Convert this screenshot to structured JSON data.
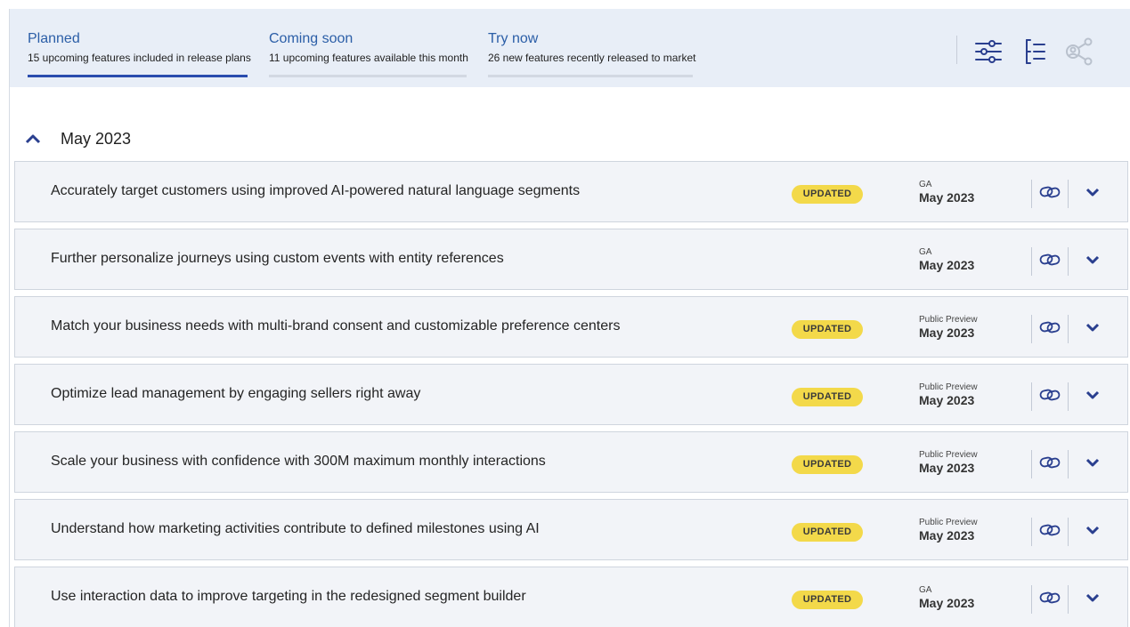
{
  "tabs": [
    {
      "title": "Planned",
      "subtitle": "15 upcoming features included in release plans",
      "active": true
    },
    {
      "title": "Coming soon",
      "subtitle": "11 upcoming features available this month",
      "active": false
    },
    {
      "title": "Try now",
      "subtitle": "26 new features recently released to market",
      "active": false
    }
  ],
  "toolbar": {
    "filter_icon": "filter-sliders-icon",
    "list_icon": "list-view-icon",
    "share_icon": "share-icon"
  },
  "month_group": {
    "label": "May 2023",
    "expanded": true
  },
  "features": [
    {
      "title": "Accurately target customers using improved AI-powered natural language segments",
      "badge": "UPDATED",
      "stage": "GA",
      "date": "May 2023"
    },
    {
      "title": "Further personalize journeys using custom events with entity references",
      "badge": "",
      "stage": "GA",
      "date": "May 2023"
    },
    {
      "title": "Match your business needs with multi-brand consent and customizable preference centers",
      "badge": "UPDATED",
      "stage": "Public Preview",
      "date": "May 2023"
    },
    {
      "title": "Optimize lead management by engaging sellers right away",
      "badge": "UPDATED",
      "stage": "Public Preview",
      "date": "May 2023"
    },
    {
      "title": "Scale your business with confidence with 300M maximum monthly interactions",
      "badge": "UPDATED",
      "stage": "Public Preview",
      "date": "May 2023"
    },
    {
      "title": "Understand how marketing activities contribute to defined milestones using AI",
      "badge": "UPDATED",
      "stage": "Public Preview",
      "date": "May 2023"
    },
    {
      "title": "Use interaction data to improve targeting in the redesigned segment builder",
      "badge": "UPDATED",
      "stage": "GA",
      "date": "May 2023"
    }
  ],
  "colors": {
    "accent": "#2a4dae",
    "header_bg": "#e8eef7",
    "badge": "#f3d94a",
    "row_bg": "#f2f4f8"
  }
}
